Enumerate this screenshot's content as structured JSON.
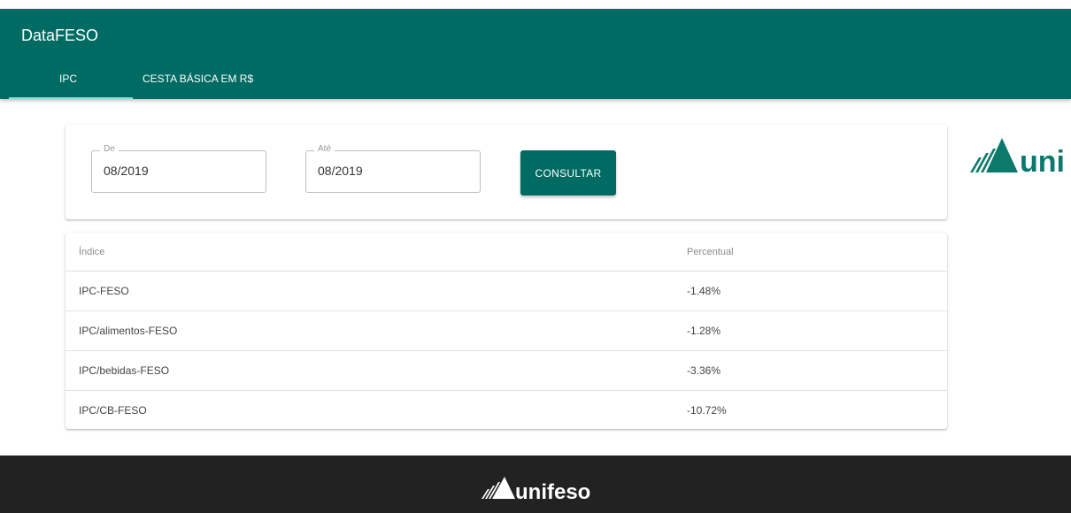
{
  "app": {
    "title": "DataFESO"
  },
  "tabs": [
    {
      "label": "IPC"
    },
    {
      "label": "CESTA BÁSICA EM R$"
    }
  ],
  "filter": {
    "from": {
      "label": "De",
      "value": "08/2019"
    },
    "to": {
      "label": "Até",
      "value": "08/2019"
    },
    "submit_label": "CONSULTAR"
  },
  "table": {
    "headers": [
      "Índice",
      "Percentual"
    ],
    "rows": [
      [
        "IPC-FESO",
        "-1.48%"
      ],
      [
        "IPC/alimentos-FESO",
        "-1.28%"
      ],
      [
        "IPC/bebidas-FESO",
        "-3.36%"
      ],
      [
        "IPC/CB-FESO",
        "-10.72%"
      ]
    ]
  },
  "branding": {
    "logo_right_text": "uni",
    "logo_footer_text": "unifeso"
  },
  "colors": {
    "primary": "#006b63",
    "footer": "#222222",
    "tab_indicator": "#7fe3d6"
  }
}
